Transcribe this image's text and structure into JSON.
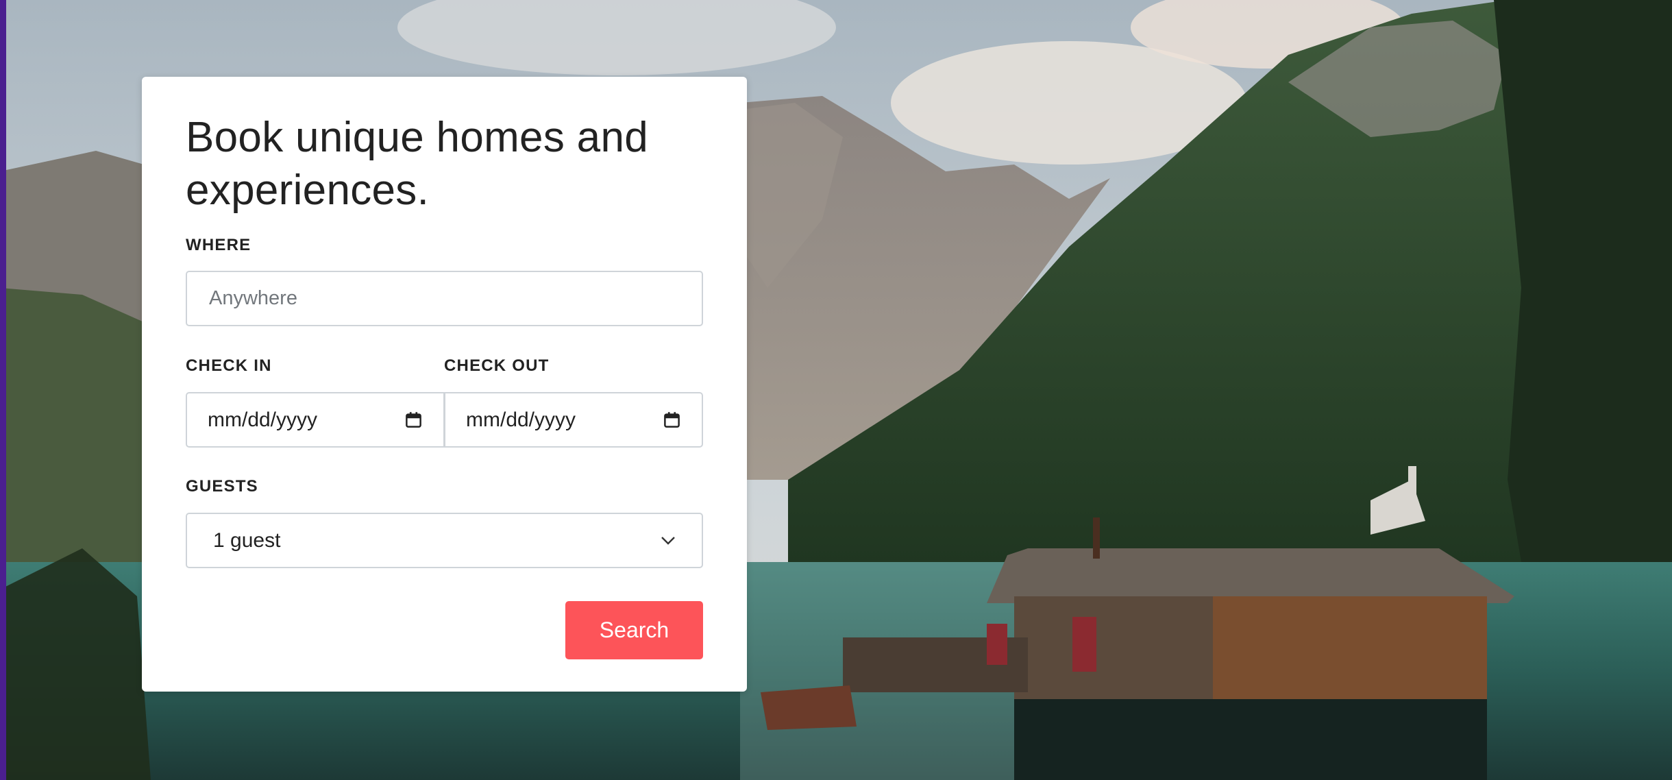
{
  "heading": "Book unique homes and experiences.",
  "where": {
    "label": "WHERE",
    "placeholder": "Anywhere",
    "value": ""
  },
  "check_in": {
    "label": "CHECK IN",
    "placeholder": "mm/dd/yyyy",
    "icon": "calendar-icon"
  },
  "check_out": {
    "label": "CHECK OUT",
    "placeholder": "mm/dd/yyyy",
    "icon": "calendar-icon"
  },
  "guests": {
    "label": "GUESTS",
    "selected": "1 guest",
    "icon": "chevron-down-icon"
  },
  "search": {
    "label": "Search"
  },
  "colors": {
    "accent": "#fd5459",
    "text": "#222222",
    "border": "#cfd4d9",
    "sidebar_stripe": "#4b1f8f"
  }
}
